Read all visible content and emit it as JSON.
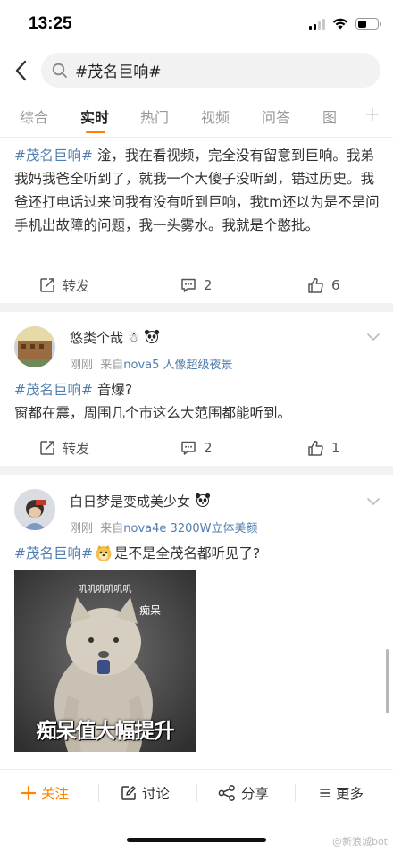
{
  "status": {
    "time": "13:25"
  },
  "search": {
    "query": "#茂名巨响#"
  },
  "tabs": [
    {
      "label": "综合"
    },
    {
      "label": "实时"
    },
    {
      "label": "热门"
    },
    {
      "label": "视频"
    },
    {
      "label": "问答"
    },
    {
      "label": "图"
    }
  ],
  "tab_more": "+",
  "posts": [
    {
      "topic": "#茂名巨响#",
      "text": " 淦，我在看视频，完全没有留意到巨响。我弟我妈我爸全听到了，就我一个大傻子没听到，错过历史。我爸还打电话过来问我有没有听到巨响，我tm还以为是不是问手机出故障的问题，我一头雾水。我就是个憨批。",
      "repost_label": "转发",
      "comments": "2",
      "likes": "6"
    },
    {
      "username": "悠类个哉",
      "time": "刚刚",
      "source_prefix": "来自",
      "source": "nova5 人像超级夜景",
      "topic": "#茂名巨响#",
      "text_line1": " 音爆?",
      "text_line2": "窗都在震，周围几个市这么大范围都能听到。",
      "repost_label": "转发",
      "comments": "2",
      "likes": "1"
    },
    {
      "username": "白日梦是变成美少女",
      "time": "刚刚",
      "source_prefix": "来自",
      "source": "nova4e 3200W立体美颜",
      "topic": "#茂名巨响#",
      "text": "是不是全茂名都听见了?",
      "meme_top": "叽叽叽叽叽叽",
      "meme_tag": "痴呆",
      "meme_caption": "痴呆值大幅提升"
    }
  ],
  "bottom_bar": {
    "follow": "关注",
    "discuss": "讨论",
    "share": "分享",
    "more": "更多"
  },
  "watermark": "@新浪城bot",
  "colors": {
    "accent": "#ff8200",
    "link": "#507daf"
  }
}
